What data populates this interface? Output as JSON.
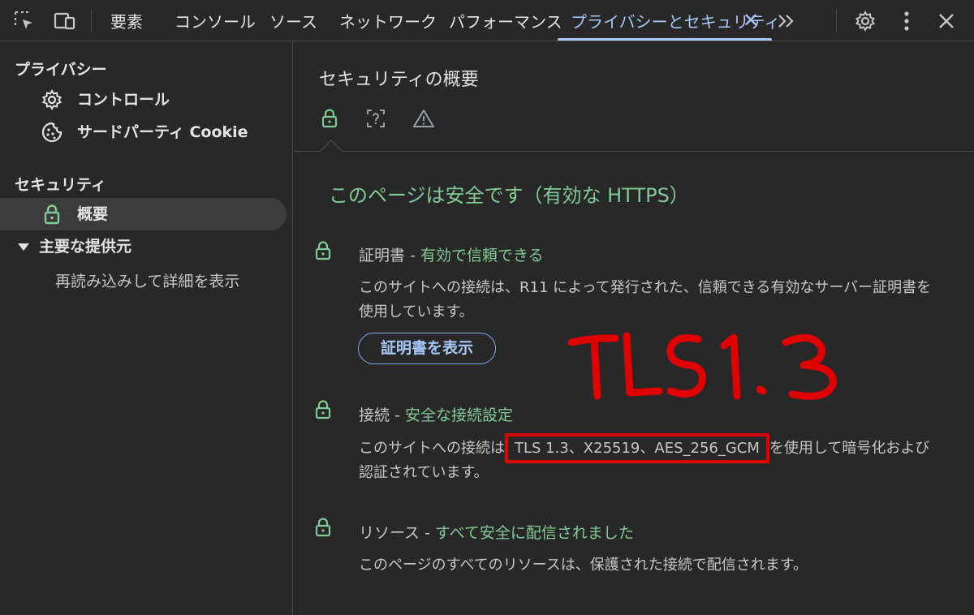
{
  "toolbar": {
    "tabs": [
      "要素",
      "コンソール",
      "ソース",
      "ネットワーク",
      "パフォーマンス",
      "プライバシーとセキュリティ"
    ],
    "active_tab_index": 5,
    "close_glyph": "✕",
    "more_tabs_glyph": "»"
  },
  "sidebar": {
    "privacy_heading": "プライバシー",
    "privacy_items": [
      {
        "icon": "gear-icon",
        "label": "コントロール"
      },
      {
        "icon": "cookie-icon",
        "label": "サードパーティ Cookie"
      }
    ],
    "security_heading": "セキュリティ",
    "security_items": [
      {
        "icon": "lock-icon",
        "label": "概要",
        "selected": true
      }
    ],
    "main_origin_group": "主要な提供元",
    "reload_note": "再読み込みして詳細を表示"
  },
  "main": {
    "title": "セキュリティの概要",
    "sub_icons": [
      "lock-icon",
      "unknown-icon",
      "warning-icon"
    ],
    "summary": "このページは安全です（有効な HTTPS）",
    "sections": [
      {
        "name": "証明書",
        "separator": "-",
        "status": "有効で信頼できる",
        "description_lines": [
          "このサイトへの接続は、R11 によって発行された、信頼できる有効なサーバー証明書を",
          "使用しています。"
        ],
        "button": "証明書を表示"
      },
      {
        "name": "接続",
        "separator": "-",
        "status": "安全な接続設定",
        "description_prefix": "このサイトへの接続は",
        "description_highlight": "TLS 1.3、X25519、AES_256_GCM",
        "description_suffix": "を使用して暗号化および",
        "description_line2": "認証されています。"
      },
      {
        "name": "リソース",
        "separator": "-",
        "status": "すべて安全に配信されました",
        "description": "このページのすべてのリソースは、保護された接続で配信されます。"
      }
    ]
  },
  "annotation": {
    "text": "TLS1.3",
    "color": "#e00000"
  },
  "colors": {
    "background": "#282828",
    "accent_blue": "#a8c7fa",
    "secure_green": "#81c995",
    "annotation_red": "#e00000"
  }
}
